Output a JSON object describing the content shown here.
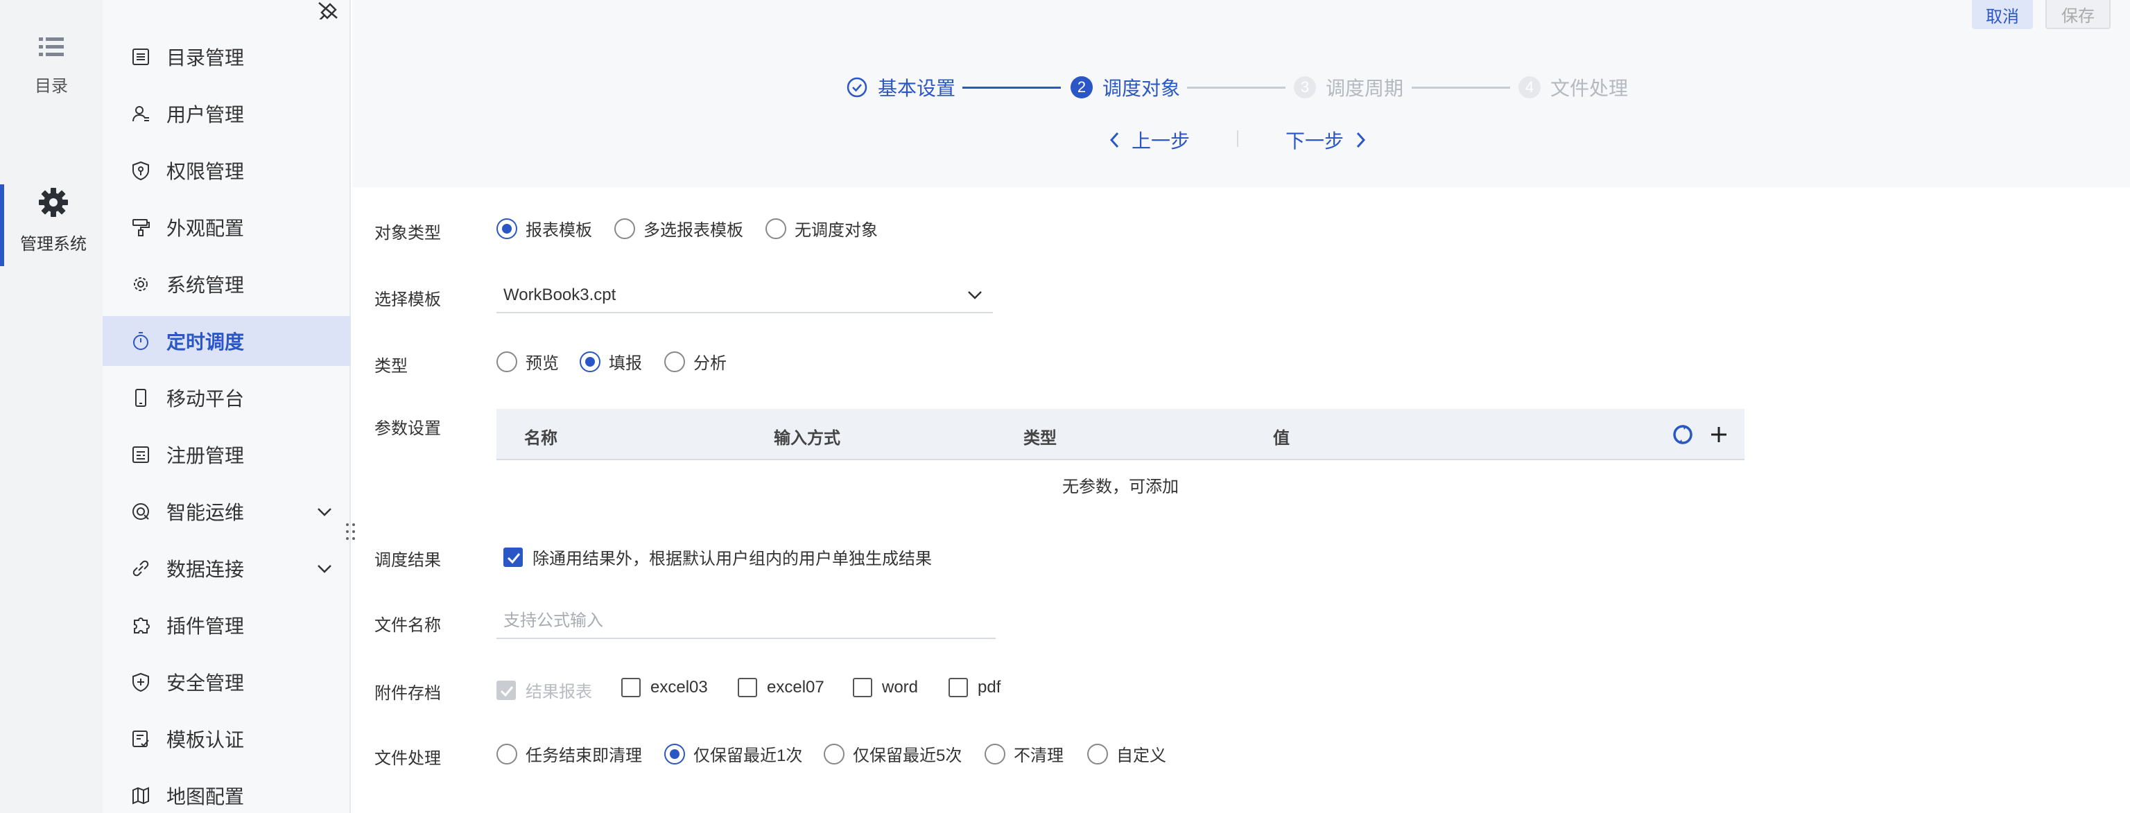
{
  "rail": {
    "items": [
      {
        "label": "目录",
        "icon": "list-icon"
      },
      {
        "label": "管理系统",
        "icon": "gear-icon"
      }
    ]
  },
  "menu": {
    "items": [
      {
        "label": "目录管理",
        "icon": "catalog-icon"
      },
      {
        "label": "用户管理",
        "icon": "user-icon"
      },
      {
        "label": "权限管理",
        "icon": "shield-key-icon"
      },
      {
        "label": "外观配置",
        "icon": "paint-roller-icon"
      },
      {
        "label": "系统管理",
        "icon": "gear-icon"
      },
      {
        "label": "定时调度",
        "icon": "timer-icon",
        "active": true
      },
      {
        "label": "移动平台",
        "icon": "mobile-icon"
      },
      {
        "label": "注册管理",
        "icon": "register-icon"
      },
      {
        "label": "智能运维",
        "icon": "ops-icon",
        "expandable": true
      },
      {
        "label": "数据连接",
        "icon": "link-icon",
        "expandable": true
      },
      {
        "label": "插件管理",
        "icon": "puzzle-icon"
      },
      {
        "label": "安全管理",
        "icon": "shield-icon"
      },
      {
        "label": "模板认证",
        "icon": "template-cert-icon"
      },
      {
        "label": "地图配置",
        "icon": "map-icon"
      }
    ]
  },
  "header": {
    "cancel_label": "取消",
    "save_label": "保存"
  },
  "steps": [
    {
      "num": "",
      "label": "基本设置",
      "state": "done"
    },
    {
      "num": "2",
      "label": "调度对象",
      "state": "current"
    },
    {
      "num": "3",
      "label": "调度周期",
      "state": "todo"
    },
    {
      "num": "4",
      "label": "文件处理",
      "state": "todo"
    }
  ],
  "nav": {
    "prev_label": "上一步",
    "next_label": "下一步"
  },
  "form": {
    "object_type": {
      "label": "对象类型",
      "options": [
        "报表模板",
        "多选报表模板",
        "无调度对象"
      ],
      "selected": "报表模板"
    },
    "template": {
      "label": "选择模板",
      "value": "WorkBook3.cpt"
    },
    "type": {
      "label": "类型",
      "options": [
        "预览",
        "填报",
        "分析"
      ],
      "selected": "填报"
    },
    "params": {
      "label": "参数设置",
      "columns": [
        "名称",
        "输入方式",
        "类型",
        "值"
      ],
      "empty_text": "无参数，可添加"
    },
    "result": {
      "label": "调度结果",
      "checkbox_label": "除通用结果外，根据默认用户组内的用户单独生成结果",
      "checked": true
    },
    "filename": {
      "label": "文件名称",
      "placeholder": "支持公式输入"
    },
    "attachments": {
      "label": "附件存档",
      "options": [
        {
          "label": "结果报表",
          "checked": true,
          "disabled": true
        },
        {
          "label": "excel03",
          "checked": false
        },
        {
          "label": "excel07",
          "checked": false
        },
        {
          "label": "word",
          "checked": false
        },
        {
          "label": "pdf",
          "checked": false
        }
      ]
    },
    "file_handling": {
      "label": "文件处理",
      "options": [
        "任务结束即清理",
        "仅保留最近1次",
        "仅保留最近5次",
        "不清理",
        "自定义"
      ],
      "selected": "仅保留最近1次"
    }
  },
  "colors": {
    "accent": "#2a56c6",
    "menu_active_bg": "#dde3f6"
  }
}
